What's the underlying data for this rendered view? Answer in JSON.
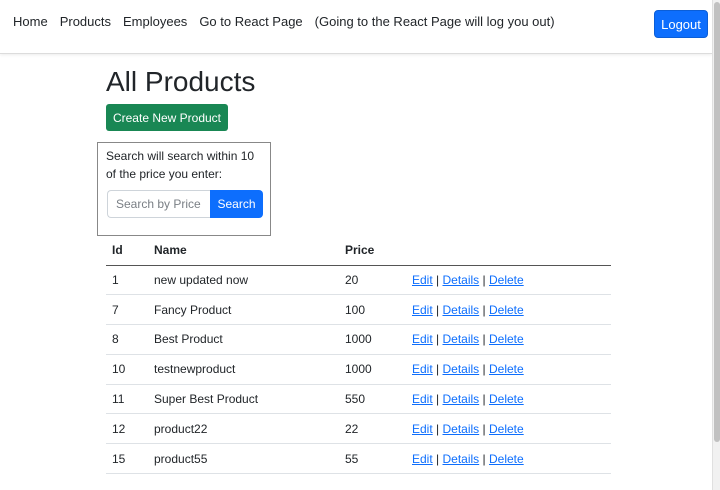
{
  "nav": {
    "items": [
      "Home",
      "Products",
      "Employees",
      "Go to React Page",
      "(Going to the React Page will log you out)"
    ],
    "logout_label": "Logout"
  },
  "page": {
    "title": "All Products",
    "create_label": "Create New Product"
  },
  "search": {
    "description": "Search will search within 10 of the price you enter:",
    "placeholder": "Search by Price",
    "button_label": "Search"
  },
  "table": {
    "headers": [
      "Id",
      "Name",
      "Price",
      ""
    ],
    "actions": [
      "Edit",
      "Details",
      "Delete"
    ],
    "separator": "|",
    "rows": [
      {
        "id": "1",
        "name": "new updated now",
        "price": "20"
      },
      {
        "id": "7",
        "name": "Fancy Product",
        "price": "100"
      },
      {
        "id": "8",
        "name": "Best Product",
        "price": "1000"
      },
      {
        "id": "10",
        "name": "testnewproduct",
        "price": "1000"
      },
      {
        "id": "11",
        "name": "Super Best Product",
        "price": "550"
      },
      {
        "id": "12",
        "name": "product22",
        "price": "22"
      },
      {
        "id": "15",
        "name": "product55",
        "price": "55"
      }
    ]
  },
  "colors": {
    "primary": "#0d6efd",
    "success": "#198754",
    "text": "#212529"
  }
}
